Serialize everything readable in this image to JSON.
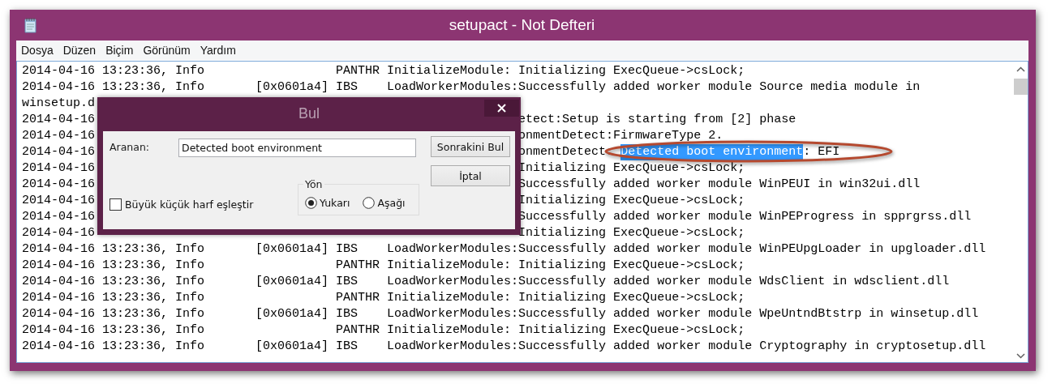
{
  "window": {
    "title": "setupact - Not Defteri"
  },
  "menu": [
    "Dosya",
    "Düzen",
    "Biçim",
    "Görünüm",
    "Yardım"
  ],
  "lines": [
    {
      "text": "2014-04-16 13:23:36, Info                  PANTHR InitializeModule: Initializing ExecQueue->csLock;"
    },
    {
      "text": "2014-04-16 13:23:36, Info       [0x0601a4] IBS    LoadWorkerModules:Successfully added worker module Source media module in"
    },
    {
      "left": "winsetup.d"
    },
    {
      "left": "2014-04-16",
      "right": "etect:Setup is starting from [2] phase"
    },
    {
      "left": "2014-04-16",
      "right": "onmentDetect:FirmwareType 2."
    },
    {
      "left": "2014-04-16",
      "right": "onmentDetect: ",
      "selection": "Detected boot environment",
      "after": ": EFI"
    },
    {
      "left": "2014-04-16",
      "right": "Initializing ExecQueue->csLock;"
    },
    {
      "left": "2014-04-16",
      "right": "Successfully added worker module WinPEUI in win32ui.dll"
    },
    {
      "left": "2014-04-16",
      "right": "Initializing ExecQueue->csLock;"
    },
    {
      "left": "2014-04-16",
      "right": "Successfully added worker module WinPEProgress in spprgrss.dll"
    },
    {
      "left": "2014-04-16",
      "right": "Initializing ExecQueue->csLock;"
    },
    {
      "text": "2014-04-16 13:23:36, Info       [0x0601a4] IBS    LoadWorkerModules:Successfully added worker module WinPEUpgLoader in upgloader.dll"
    },
    {
      "text": "2014-04-16 13:23:36, Info                  PANTHR InitializeModule: Initializing ExecQueue->csLock;"
    },
    {
      "text": "2014-04-16 13:23:36, Info       [0x0601a4] IBS    LoadWorkerModules:Successfully added worker module WdsClient in wdsclient.dll"
    },
    {
      "text": "2014-04-16 13:23:36, Info                  PANTHR InitializeModule: Initializing ExecQueue->csLock;"
    },
    {
      "text": "2014-04-16 13:23:36, Info       [0x0601a4] IBS    LoadWorkerModules:Successfully added worker module WpeUntndBtstrp in winsetup.dll"
    },
    {
      "text": "2014-04-16 13:23:36, Info                  PANTHR InitializeModule: Initializing ExecQueue->csLock;"
    },
    {
      "text": "2014-04-16 13:23:36, Info       [0x0601a4] IBS    LoadWorkerModules:Successfully added worker module Cryptography in cryptosetup.dll"
    }
  ],
  "find_dialog": {
    "title": "Bul",
    "search_label": "Aranan:",
    "search_value": "Detected boot environment",
    "find_next": "Sonrakini Bul",
    "cancel": "İptal",
    "direction": {
      "label": "Yön",
      "options": [
        {
          "label": "Yukarı",
          "selected": true
        },
        {
          "label": "Aşağı",
          "selected": false
        }
      ]
    },
    "match_case": {
      "label": "Büyük küçük harf eşleştir",
      "checked": false
    }
  }
}
